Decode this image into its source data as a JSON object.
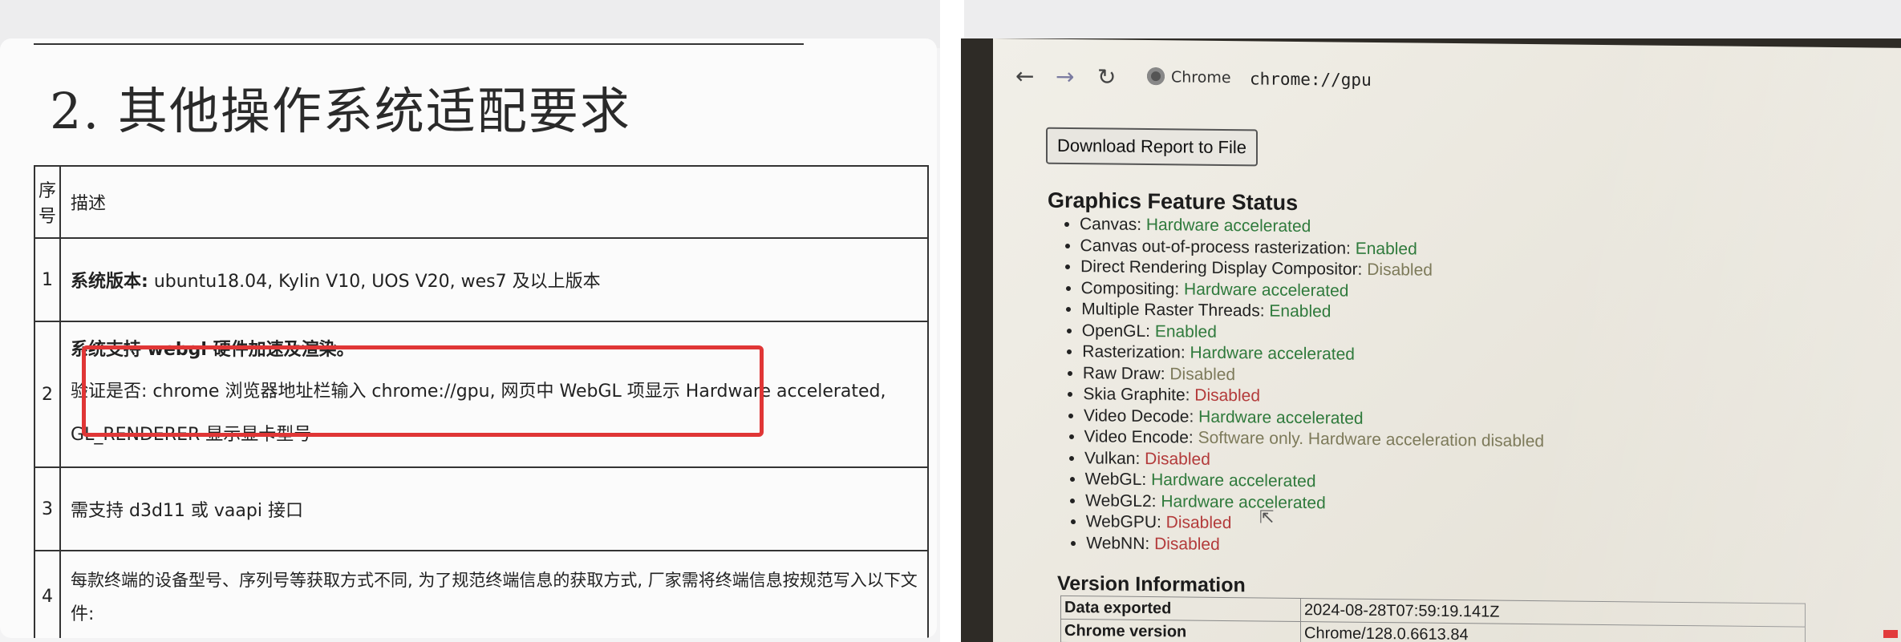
{
  "doc": {
    "heading": "2. 其他操作系统适配要求",
    "table": {
      "headers": [
        "序号",
        "描述"
      ],
      "rows": [
        {
          "no": "1",
          "label": "系统版本:",
          "text": " ubuntu18.04, Kylin V10, UOS V20, wes7 及以上版本"
        },
        {
          "no": "2",
          "line1": "系统支持 webgl 硬件加速及渲染。",
          "line2": "验证是否: chrome 浏览器地址栏输入 chrome://gpu, 网页中 WebGL 项显示 Hardware accelerated,",
          "line3": "GL_RENDERER 显示显卡型号"
        },
        {
          "no": "3",
          "text": "需支持 d3d11 或 vaapi 接口"
        },
        {
          "no": "4",
          "line1": "每款终端的设备型号、序列号等获取方式不同, 为了规范终端信息的获取方式, 厂家需将终端信息按规范写入以下文",
          "line2": "件:"
        }
      ]
    }
  },
  "browser": {
    "tab_label": "Chrome",
    "url": "chrome://gpu",
    "icons": {
      "back": "back-arrow-icon",
      "forward": "forward-arrow-icon",
      "reload": "reload-icon",
      "site": "chrome-icon"
    },
    "download_label": "Download Report to File",
    "feature_status_title": "Graphics Feature Status",
    "features": [
      {
        "name": "Canvas: ",
        "status": "Hardware accelerated",
        "state": "ok"
      },
      {
        "name": "Canvas out-of-process rasterization: ",
        "status": "Enabled",
        "state": "ok"
      },
      {
        "name": "Direct Rendering Display Compositor: ",
        "status": "Disabled",
        "state": "warn"
      },
      {
        "name": "Compositing: ",
        "status": "Hardware accelerated",
        "state": "ok"
      },
      {
        "name": "Multiple Raster Threads: ",
        "status": "Enabled",
        "state": "ok"
      },
      {
        "name": "OpenGL: ",
        "status": "Enabled",
        "state": "ok"
      },
      {
        "name": "Rasterization: ",
        "status": "Hardware accelerated",
        "state": "ok"
      },
      {
        "name": "Raw Draw: ",
        "status": "Disabled",
        "state": "warn"
      },
      {
        "name": "Skia Graphite: ",
        "status": "Disabled",
        "state": "bad"
      },
      {
        "name": "Video Decode: ",
        "status": "Hardware accelerated",
        "state": "ok"
      },
      {
        "name": "Video Encode: ",
        "status": "Software only. Hardware acceleration disabled",
        "state": "warn"
      },
      {
        "name": "Vulkan: ",
        "status": "Disabled",
        "state": "bad"
      },
      {
        "name": "WebGL: ",
        "status": "Hardware accelerated",
        "state": "ok"
      },
      {
        "name": "WebGL2: ",
        "status": "Hardware accelerated",
        "state": "ok"
      },
      {
        "name": "WebGPU: ",
        "status": "Disabled",
        "state": "bad"
      },
      {
        "name": "WebNN: ",
        "status": "Disabled",
        "state": "bad"
      }
    ],
    "version_title": "Version Information",
    "version_rows": [
      {
        "key": "Data exported",
        "value": "2024-08-28T07:59:19.141Z"
      },
      {
        "key": "Chrome version",
        "value": "Chrome/128.0.6613.84"
      }
    ],
    "colors": {
      "ok": "#2f7a3c",
      "bad": "#b33a3a",
      "warn": "#7d7a5a",
      "highlight": "#e03636"
    }
  }
}
